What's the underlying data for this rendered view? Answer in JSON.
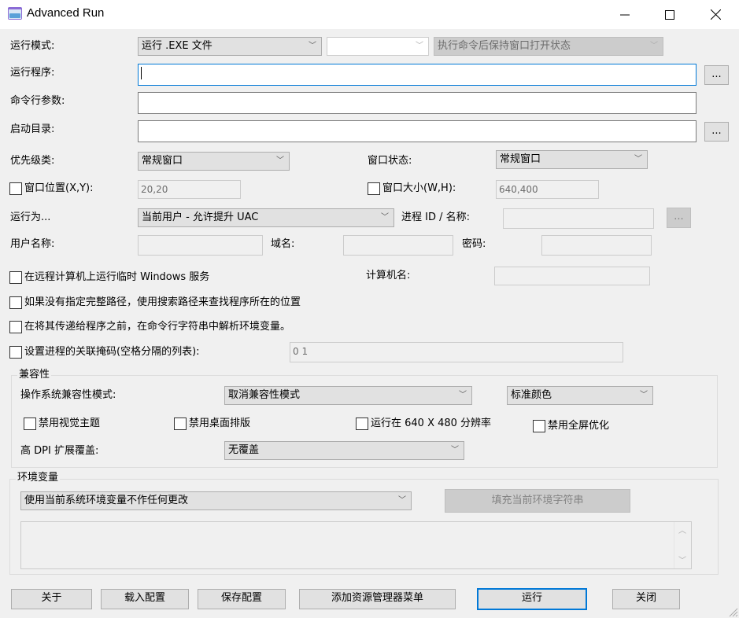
{
  "window": {
    "title": "Advanced Run",
    "minimize_icon": "minimize-icon",
    "maximize_icon": "maximize-icon",
    "close_icon": "close-icon"
  },
  "run_mode": {
    "label": "运行模式:",
    "value": "运行 .EXE 文件",
    "secondary_value": "",
    "keep_window_value": "执行命令后保持窗口打开状态"
  },
  "program": {
    "label": "运行程序:",
    "value": "",
    "browse_label": "..."
  },
  "cmdline": {
    "label": "命令行参数:",
    "value": ""
  },
  "start_dir": {
    "label": "启动目录:",
    "value": "",
    "browse_label": "..."
  },
  "priority": {
    "label": "优先级类:",
    "value": "常规窗口"
  },
  "window_state": {
    "label": "窗口状态:",
    "value": "常规窗口"
  },
  "window_pos": {
    "label": "窗口位置(X,Y):",
    "value": "20,20",
    "checked": false
  },
  "window_size": {
    "label": "窗口大小(W,H):",
    "value": "640,400",
    "checked": false
  },
  "run_as": {
    "label": "运行为...",
    "value": "当前用户 - 允许提升 UAC"
  },
  "process": {
    "label": "进程 ID / 名称:",
    "value": "",
    "browse_label": "..."
  },
  "username": {
    "label": "用户名称:",
    "value": ""
  },
  "domain": {
    "label": "域名:",
    "value": ""
  },
  "password": {
    "label": "密码:",
    "value": ""
  },
  "options": [
    {
      "label": "在远程计算机上运行临时 Windows 服务",
      "checked": false
    },
    {
      "label": "如果没有指定完整路径，使用搜索路径来查找程序所在的位置",
      "checked": false
    },
    {
      "label": "在将其传递给程序之前，在命令行字符串中解析环境变量。",
      "checked": false
    },
    {
      "label": "设置进程的关联掩码(空格分隔的列表):",
      "checked": false
    }
  ],
  "computer_name": {
    "label": "计算机名:",
    "value": ""
  },
  "affinity_value": "0 1",
  "compat": {
    "title": "兼容性",
    "os_mode_label": "操作系统兼容性模式:",
    "os_mode_value": "取消兼容性模式",
    "color_value": "标准颜色",
    "checks": [
      {
        "label": "禁用视觉主题",
        "checked": false
      },
      {
        "label": "禁用桌面排版",
        "checked": false
      },
      {
        "label": "运行在 640 X 480 分辨率",
        "checked": false
      },
      {
        "label": "禁用全屏优化",
        "checked": false
      }
    ],
    "dpi_label": "高 DPI 扩展覆盖:",
    "dpi_value": "无覆盖"
  },
  "env": {
    "title": "环境变量",
    "mode_value": "使用当前系统环境变量不作任何更改",
    "fill_button": "填充当前环境字符串",
    "text": ""
  },
  "buttons": {
    "about": "关于",
    "load": "载入配置",
    "save": "保存配置",
    "explorer_menu": "添加资源管理器菜单",
    "run": "运行",
    "close": "关闭"
  }
}
